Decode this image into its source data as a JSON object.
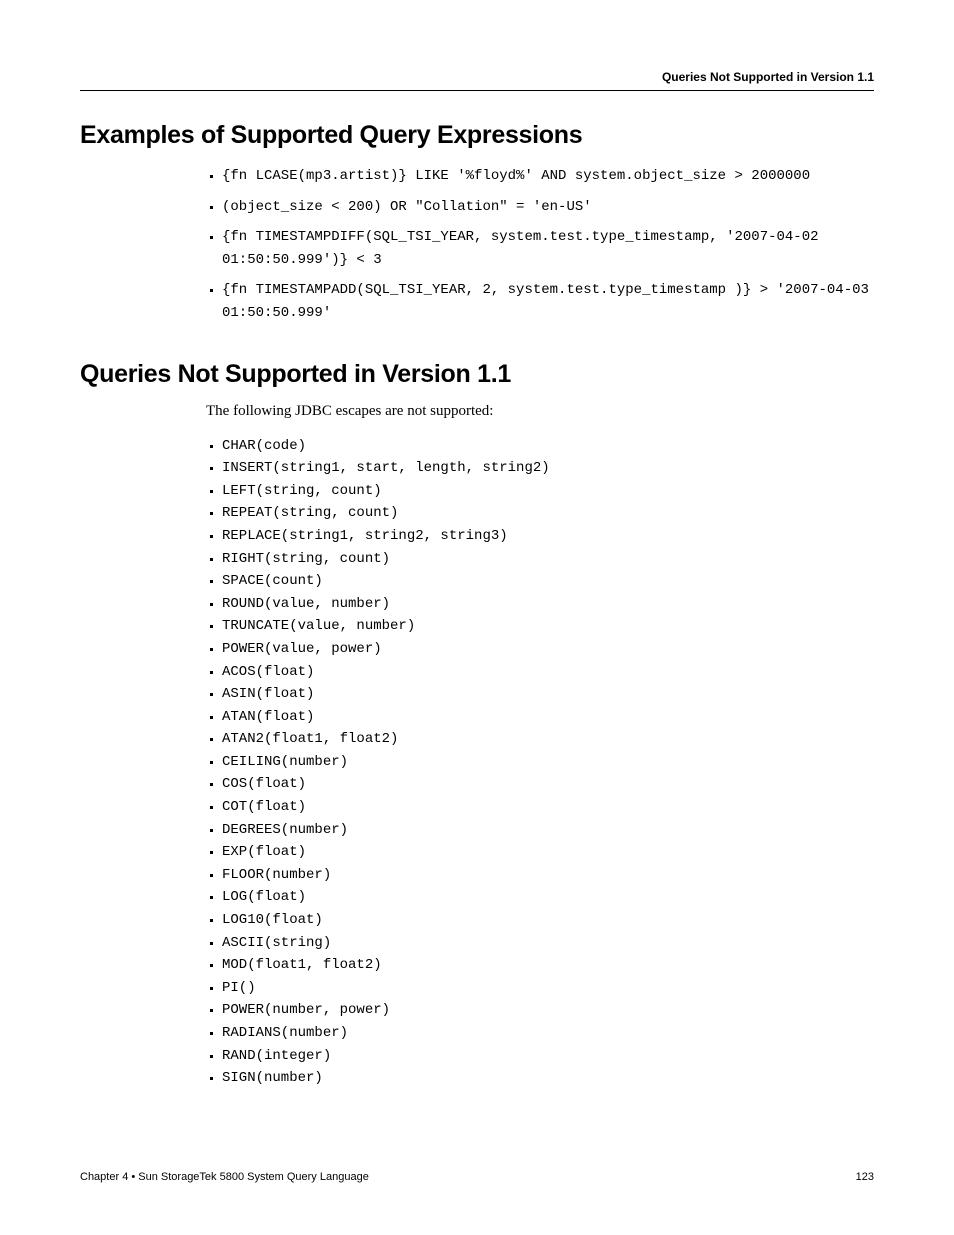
{
  "header": {
    "running_title": "Queries Not Supported in Version 1.1"
  },
  "section1": {
    "title": "Examples of Supported Query Expressions",
    "items": [
      "{fn LCASE(mp3.artist)} LIKE '%floyd%' AND system.object_size > 2000000",
      "(object_size < 200) OR \"Collation\" = 'en-US'",
      "{fn TIMESTAMPDIFF(SQL_TSI_YEAR, system.test.type_timestamp, '2007-04-02 01:50:50.999')} < 3",
      "{fn TIMESTAMPADD(SQL_TSI_YEAR, 2, system.test.type_timestamp )} > '2007-04-03 01:50:50.999'"
    ]
  },
  "section2": {
    "title": "Queries Not Supported in Version 1.1",
    "intro": "The following JDBC escapes are not supported:",
    "items": [
      "CHAR(code)",
      "INSERT(string1, start, length, string2)",
      "LEFT(string, count)",
      "REPEAT(string, count)",
      "REPLACE(string1, string2, string3)",
      "RIGHT(string, count)",
      "SPACE(count)",
      "ROUND(value, number)",
      "TRUNCATE(value, number)",
      "POWER(value, power)",
      "ACOS(float)",
      "ASIN(float)",
      "ATAN(float)",
      "ATAN2(float1, float2)",
      "CEILING(number)",
      "COS(float)",
      "COT(float)",
      "DEGREES(number)",
      "EXP(float)",
      "FLOOR(number)",
      "LOG(float)",
      "LOG10(float)",
      "ASCII(string)",
      "MOD(float1, float2)",
      "PI()",
      "POWER(number, power)",
      "RADIANS(number)",
      "RAND(integer)",
      "SIGN(number)"
    ]
  },
  "footer": {
    "chapter": "Chapter 4 • Sun StorageTek 5800 System Query Language",
    "page": "123"
  }
}
